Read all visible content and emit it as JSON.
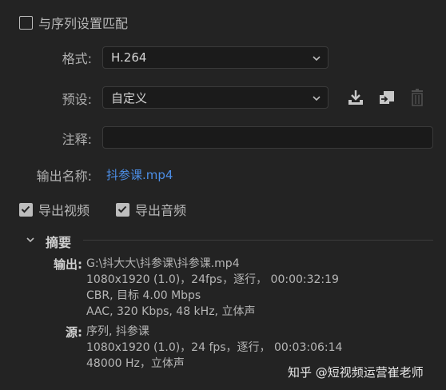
{
  "match_sequence": {
    "label": "与序列设置匹配",
    "checked": false
  },
  "format": {
    "label": "格式:",
    "value": "H.264"
  },
  "preset": {
    "label": "预设:",
    "value": "自定义"
  },
  "comments": {
    "label": "注释:",
    "value": ""
  },
  "output_name": {
    "label": "输出名称:",
    "value": "抖参课.mp4"
  },
  "export_video": {
    "label": "导出视频",
    "checked": true
  },
  "export_audio": {
    "label": "导出音频",
    "checked": true
  },
  "summary": {
    "title": "摘要",
    "output_key": "输出:",
    "output_lines": [
      "G:\\抖大大\\抖参课\\抖参课.mp4",
      "1080x1920 (1.0)，24fps，逐行，  00:00:32:19",
      "CBR, 目标 4.00  Mbps",
      "AAC, 320 Kbps, 48  kHz, 立体声"
    ],
    "source_key": "源:",
    "source_lines": [
      "序列, 抖参课",
      "1080x1920 (1.0)，24 fps，逐行，  00:03:06:14",
      "48000 Hz，立体声"
    ]
  },
  "watermark": "知乎 @短视频运营崔老师",
  "icons": [
    "save-preset-icon",
    "import-preset-icon",
    "delete-preset-icon",
    "chevron-down-icon",
    "collapse-chevron-icon"
  ]
}
